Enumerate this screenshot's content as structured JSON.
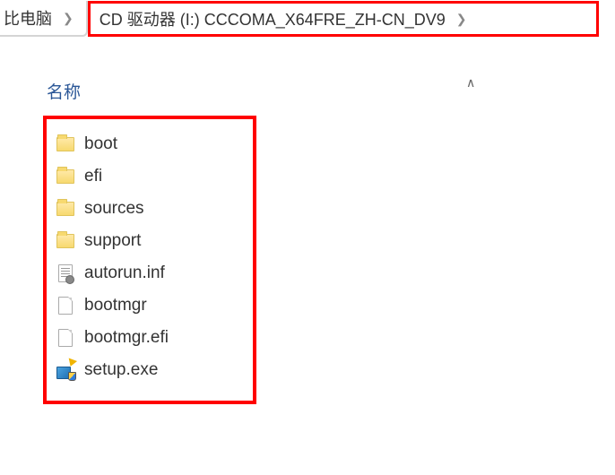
{
  "breadcrumb": {
    "root": "比电脑",
    "location": "CD 驱动器 (I:) CCCOMA_X64FRE_ZH-CN_DV9"
  },
  "column_header": "名称",
  "items": [
    {
      "name": "boot",
      "type": "folder"
    },
    {
      "name": "efi",
      "type": "folder"
    },
    {
      "name": "sources",
      "type": "folder"
    },
    {
      "name": "support",
      "type": "folder"
    },
    {
      "name": "autorun.inf",
      "type": "inf"
    },
    {
      "name": "bootmgr",
      "type": "file"
    },
    {
      "name": "bootmgr.efi",
      "type": "file"
    },
    {
      "name": "setup.exe",
      "type": "exe"
    }
  ]
}
